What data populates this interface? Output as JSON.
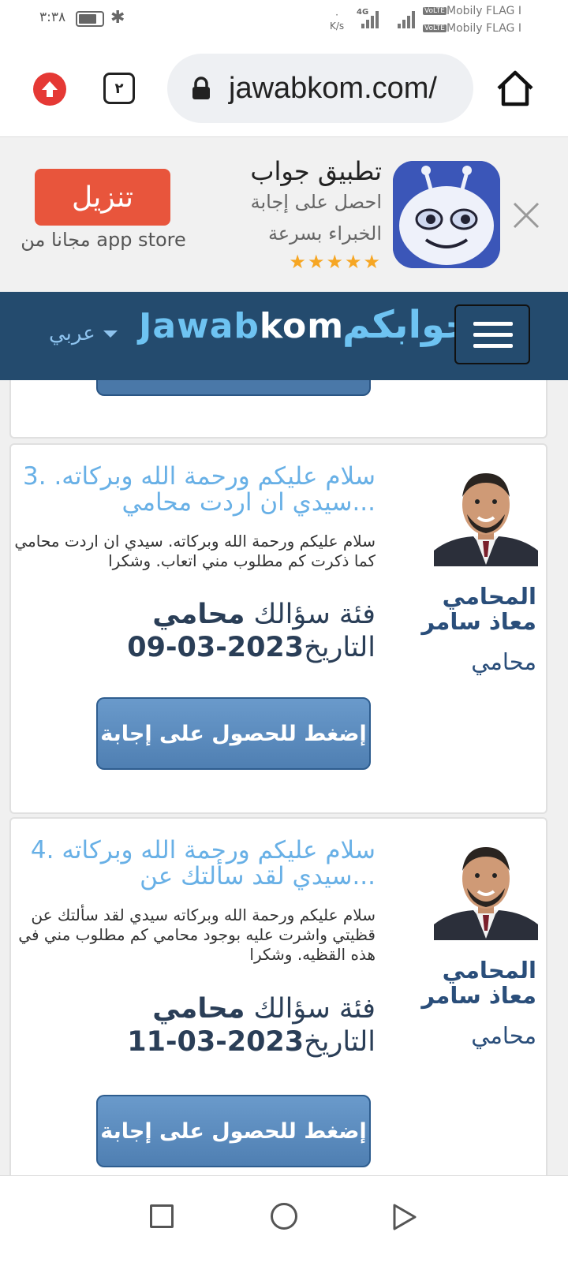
{
  "status_bar": {
    "time": "٣:٣٨",
    "network_speed": "K/s",
    "network_type": "4G",
    "carrier_1": "Mobily FLAG I",
    "carrier_2": "Mobily FLAG I",
    "volte": "VoLTE"
  },
  "browser": {
    "tab_count": "٢",
    "url": "jawabkom.com/"
  },
  "app_banner": {
    "download_label": "تنزيل",
    "download_sub": "مجانا من app store",
    "title": "تطبيق جواب",
    "description": "احصل على إجابة الخبراء بسرعة",
    "stars": "★★★★★",
    "rating": 5
  },
  "site_header": {
    "language": "عربي",
    "logo_en_prefix": "Jawab",
    "logo_en_suffix": "kom",
    "logo_ar": "جوابكم"
  },
  "questions": [
    {
      "title": "3. سلام عليكم ورحمة الله وبركاته. سيدي ان اردت محامي...",
      "body": "سلام عليكم ورحمة الله وبركاته. سيدي ان اردت محامي كما ذكرت كم مطلوب مني اتعاب. وشكرا",
      "category_label": "فئة سؤالك",
      "category": "محامي",
      "date_label": "التاريخ",
      "date": "2023-03-09",
      "lawyer_name": "المحامي معاذ سامر",
      "lawyer_role": "محامي",
      "button_label": "إضغط للحصول على إجابة"
    },
    {
      "title": "4. سلام عليكم ورحمة الله وبركاته سيدي لقد سألتك عن...",
      "body": "سلام عليكم ورحمة الله وبركاته سيدي لقد سألتك عن قظيتي واشرت عليه بوجود محامي كم مطلوب مني في هذه القظيه. وشكرا",
      "category_label": "فئة سؤالك",
      "category": "محامي",
      "date_label": "التاريخ",
      "date": "2023-03-11",
      "lawyer_name": "المحامي معاذ سامر",
      "lawyer_role": "محامي",
      "button_label": "إضغط للحصول على إجابة"
    }
  ],
  "colors": {
    "header_bg": "#244b6e",
    "logo_accent": "#6ec3f2",
    "download_button": "#e8553c",
    "answer_button": "#4f7fb2",
    "question_title": "#68b0e6"
  }
}
